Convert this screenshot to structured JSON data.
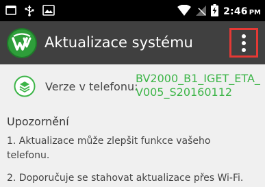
{
  "status_bar": {
    "time": "2:46",
    "ampm": "PM",
    "icons": [
      "screenshot-icon",
      "usb-icon",
      "gallery-icon",
      "wifi-icon",
      "no-signal-icon",
      "battery-charging-icon"
    ]
  },
  "app_bar": {
    "title": "Aktualizace systému",
    "logo_icon": "app-logo-icon",
    "menu_icon": "overflow-menu-icon",
    "highlight_color": "#e53935"
  },
  "version": {
    "label": "Verze v telefonu:",
    "value": "BV2000_B1_IGET_ETA_V005_S20160112",
    "value_color": "#3db548"
  },
  "notice": {
    "heading": "Upozornění",
    "items": [
      "1. Aktualizace může zlepšit funkce vašeho telefonu.",
      "2. Doporučuje se stahovat aktualizace přes Wi-Fi."
    ]
  }
}
